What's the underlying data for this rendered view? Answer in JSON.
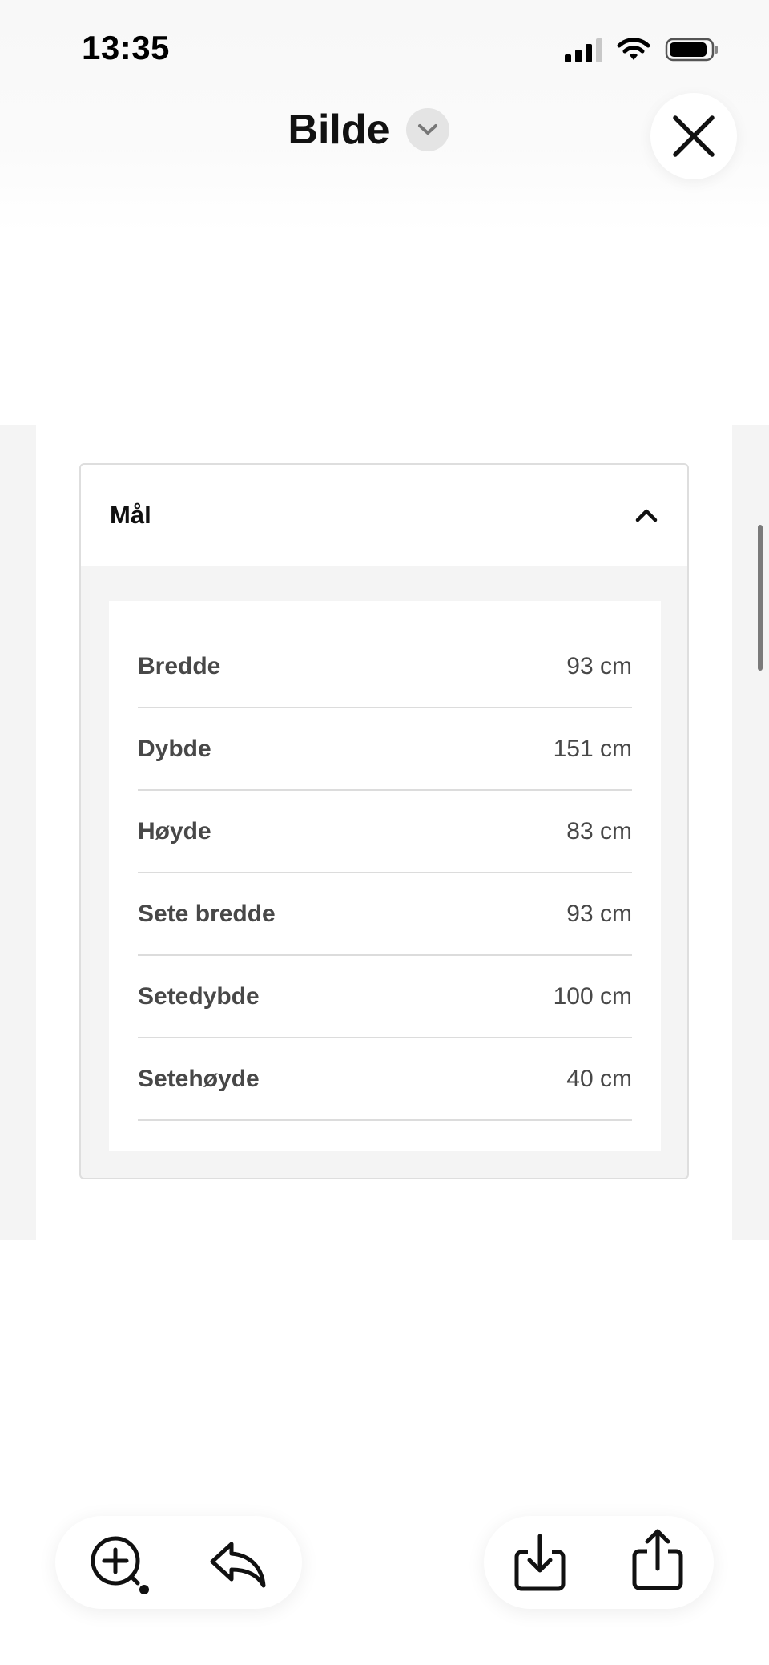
{
  "status_bar": {
    "time": "13:35"
  },
  "header": {
    "title": "Bilde",
    "title_menu_icon": "chevron-down-icon",
    "close_icon": "close-icon"
  },
  "card": {
    "title": "Mål",
    "toggle_icon": "chevron-up-icon",
    "rows": [
      {
        "label": "Bredde",
        "value": "93 cm"
      },
      {
        "label": "Dybde",
        "value": "151 cm"
      },
      {
        "label": "Høyde",
        "value": "83 cm"
      },
      {
        "label": "Sete bredde",
        "value": "93 cm"
      },
      {
        "label": "Setedybde",
        "value": "100 cm"
      },
      {
        "label": "Setehøyde",
        "value": "40 cm"
      }
    ]
  },
  "toolbar": {
    "left": [
      "zoom-icon",
      "reply-icon"
    ],
    "right": [
      "save-icon",
      "share-icon"
    ]
  },
  "colors": {
    "text_dark": "#111111",
    "text_muted": "#484848",
    "panel_bg": "#f4f4f4",
    "divider": "#dcdcdc"
  }
}
